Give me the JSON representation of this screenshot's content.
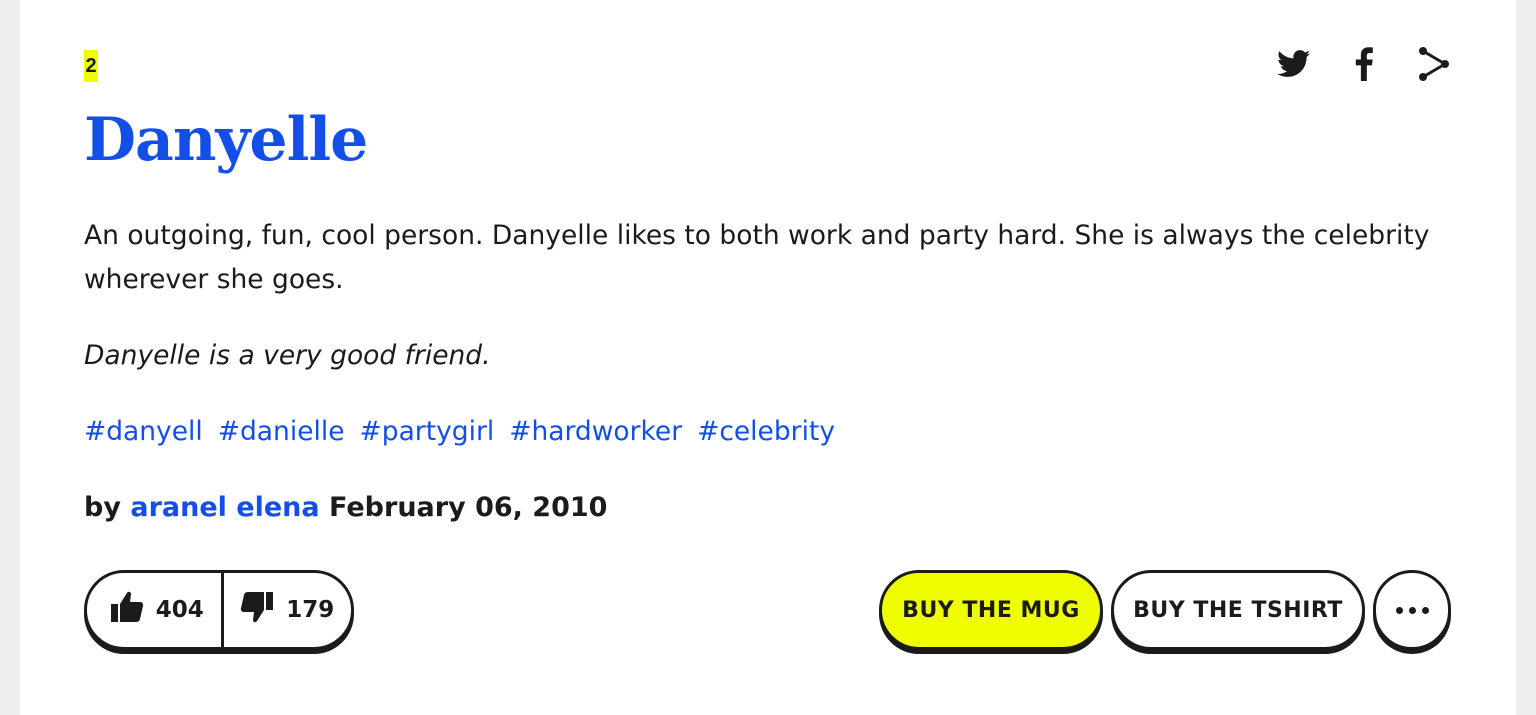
{
  "definition": {
    "rank": "2",
    "word": "Danyelle",
    "meaning": "An outgoing, fun, cool person. Danyelle likes to both work and party hard. She is always the celebrity wherever she goes.",
    "example": "Danyelle is a very good friend.",
    "tags": [
      "#danyell",
      "#danielle",
      "#partygirl",
      "#hardworker",
      "#celebrity"
    ],
    "contributor": {
      "prefix": "by",
      "author": "aranel elena",
      "date": "February 06, 2010"
    }
  },
  "share": {
    "icons": [
      "twitter-icon",
      "facebook-icon",
      "share-icon"
    ]
  },
  "votes": {
    "up_count": "404",
    "down_count": "179"
  },
  "actions": {
    "mug_label": "BUY THE MUG",
    "tshirt_label": "BUY THE TSHIRT",
    "more_icon": "more-dots-icon"
  },
  "colors": {
    "accent_blue": "#134fe6",
    "highlight_yellow": "#efff00",
    "text_dark": "#1b1b1b",
    "page_bg": "#efeff0"
  }
}
